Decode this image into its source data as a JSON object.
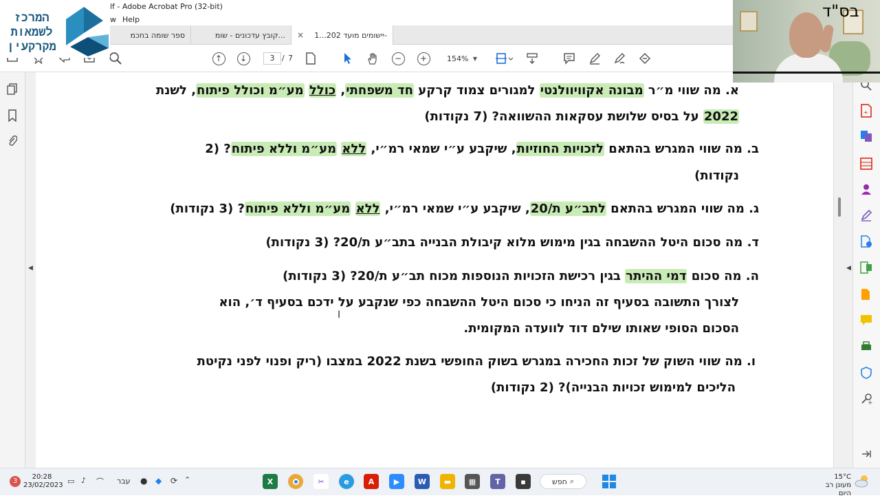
{
  "window": {
    "title": "lf - Adobe Acrobat Pro (32-bit)",
    "menu": [
      "w",
      "Help"
    ]
  },
  "tabs": [
    {
      "label": "ספר שומה בחכמ"
    },
    {
      "label": "קובץ עדכונים - שומ..."
    },
    {
      "label": "יישומים מועד 202...1-",
      "close": "×"
    }
  ],
  "toolbar": {
    "page_current": "3",
    "page_separator": "/",
    "page_total": "7",
    "zoom": "154%"
  },
  "logo": {
    "lines": [
      "המרכז",
      "לשמאות",
      "מקרקעין"
    ]
  },
  "webcam": {
    "overlay_text": "בס\"ד"
  },
  "document": {
    "lines": [
      {
        "segments": [
          {
            "t": "א. מה שווי מ״ר "
          },
          {
            "t": "מבונה אקוויוולנטי",
            "hl": true
          },
          {
            "t": " למגורים צמוד קרקע "
          },
          {
            "t": "חד משפחתי",
            "hl": true
          },
          {
            "t": ", "
          },
          {
            "t": "כולל",
            "hl": true,
            "ul": true
          },
          {
            "t": " "
          },
          {
            "t": "מע״מ וכולל פיתוח",
            "hl": true
          },
          {
            "t": ", לשנת"
          }
        ]
      },
      {
        "segments": [
          {
            "t": "2022",
            "hl": true
          },
          {
            "t": " על בסיס שלושת עסקאות ההשוואה? (7 נקודות)"
          }
        ]
      },
      {
        "segments": [
          {
            "t": "ב. מה שווי המגרש בהתאם "
          },
          {
            "t": "לזכויות החוזיות",
            "hl": true
          },
          {
            "t": ", שיקבע ע״י שמאי רמ״י, "
          },
          {
            "t": "ללא",
            "hl": true,
            "ul": true
          },
          {
            "t": " "
          },
          {
            "t": "מע״מ וללא פיתוח",
            "hl": true
          },
          {
            "t": "? (2"
          }
        ]
      },
      {
        "segments": [
          {
            "t": "נקודות)"
          }
        ]
      },
      {
        "segments": [
          {
            "t": "ג. מה שווי המגרש בהתאם "
          },
          {
            "t": "לתב״ע ת/20",
            "hl": true
          },
          {
            "t": ", שיקבע ע״י שמאי רמ״י, "
          },
          {
            "t": "ללא",
            "hl": true,
            "ul": true
          },
          {
            "t": " "
          },
          {
            "t": "מע״מ וללא פיתוח",
            "hl": true
          },
          {
            "t": "? (3 נקודות)"
          }
        ]
      },
      {
        "segments": [
          {
            "t": "ד. מה סכום היטל ההשבחה בגין מימוש מלוא קיבולת הבנייה בתב״ע ת/20? (3 נקודות)"
          }
        ]
      },
      {
        "segments": [
          {
            "t": "ה. מה סכום "
          },
          {
            "t": "דמי ההיתר",
            "hl": true
          },
          {
            "t": " בגין רכישת הזכויות הנוספות מכוח תב״ע ת/20? (3 נקודות)"
          }
        ]
      },
      {
        "segments": [
          {
            "t": "לצורך התשובה בסעיף זה הניחו כי סכום היטל ההשבחה כפי שנקבע על ידכם בסעיף ד׳, הוא"
          }
        ]
      },
      {
        "segments": [
          {
            "t": "הסכום הסופי שאותו שילם דוד לוועדה המקומית."
          }
        ]
      },
      {
        "segments": [
          {
            "t": "ו. מה שווי השוק של זכות החכירה במגרש בשוק החופשי בשנת 2022 במצבו (ריק ופנוי לפני נקיטת"
          }
        ]
      },
      {
        "segments": [
          {
            "t": "הליכים למימוש זכויות הבנייה)? (2 נקודות)"
          }
        ]
      }
    ]
  },
  "taskbar": {
    "time": "20:28",
    "date": "23/02/2023",
    "lang": "עבר",
    "search": "חפש",
    "weather_temp": "15°C",
    "weather_desc": "מעונן רב היום",
    "badge": "3"
  },
  "colors": {
    "highlight": "#c9ecb6",
    "acrobat_red": "#d81e05",
    "accent_blue": "#2680eb"
  }
}
